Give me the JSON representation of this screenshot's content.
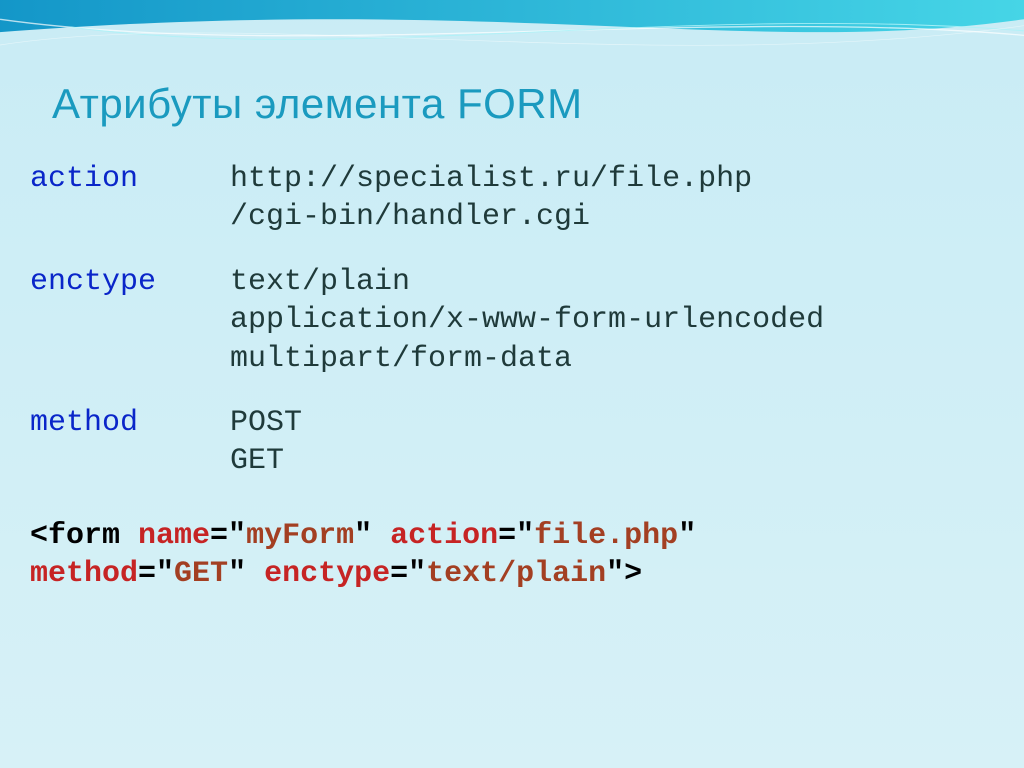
{
  "title": "Атрибуты элемента FORM",
  "attrs": {
    "action": {
      "name": "action",
      "values": [
        "http://specialist.ru/file.php",
        "/cgi-bin/handler.cgi"
      ]
    },
    "enctype": {
      "name": "enctype",
      "values": [
        "text/plain",
        "application/x-www-form-urlencoded",
        "multipart/form-data"
      ]
    },
    "method": {
      "name": "method",
      "values": [
        "POST",
        "GET"
      ]
    }
  },
  "example": {
    "p1": "<form ",
    "p2": "name",
    "p3": "=\"",
    "p4": "myForm",
    "p5": "\" ",
    "p6": "action",
    "p7": "=\"",
    "p8": "file.php",
    "p9": "\"",
    "p10": "method",
    "p11": "=\"",
    "p12": "GET",
    "p13": "\" ",
    "p14": "enctype",
    "p15": "=\"",
    "p16": "text/plain",
    "p17": "\">"
  }
}
